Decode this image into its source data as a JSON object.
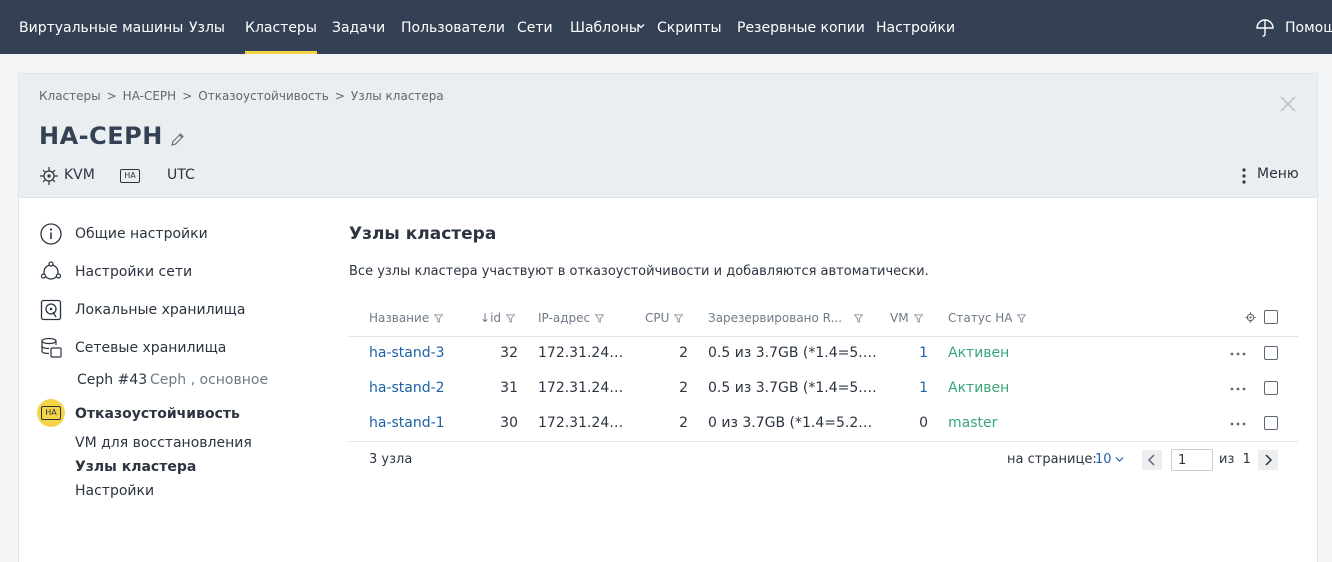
{
  "nav": {
    "items": [
      "Виртуальные машины",
      "Узлы",
      "Кластеры",
      "Задачи",
      "Пользователи",
      "Сети",
      "Шаблоны",
      "Скрипты",
      "Резервные копии",
      "Настройки"
    ],
    "active": "Кластеры",
    "help_label": "Помощь",
    "accent_color": "#f5d547"
  },
  "breadcrumb": [
    "Кластеры",
    "HA-CEPH",
    "Отказоустойчивость",
    "Узлы кластера"
  ],
  "header": {
    "title": "HA-CEPH",
    "tags": {
      "virtualization": "KVM",
      "ha_badge": "HA",
      "timezone": "UTC"
    },
    "menu_label": "Меню"
  },
  "sidebar": {
    "items": [
      {
        "label": "Общие настройки",
        "icon": "info-icon"
      },
      {
        "label": "Настройки сети",
        "icon": "network-icon"
      },
      {
        "label": "Локальные хранилища",
        "icon": "local-storage-icon"
      },
      {
        "label": "Сетевые хранилища",
        "icon": "network-storage-icon"
      },
      {
        "label": "Отказоустойчивость",
        "icon": "ha-icon"
      }
    ],
    "storage_sub": {
      "name": "Ceph #43",
      "desc": "Ceph , основное"
    },
    "ha_sub": [
      "VM для восстановления",
      "Узлы кластера",
      "Настройки"
    ],
    "ha_sub_active": "Узлы кластера"
  },
  "main": {
    "title": "Узлы кластера",
    "description": "Все узлы кластера участвуют в отказоустойчивости и добавляются автоматически.",
    "columns": [
      "Название",
      "id",
      "IP-адрес",
      "CPU",
      "Зарезервировано R...",
      "VM",
      "Статус HA"
    ],
    "sort_indicator": "↓",
    "rows": [
      {
        "name": "ha-stand-3",
        "id": "32",
        "ip": "172.31.24…",
        "cpu": "2",
        "reserved": "0.5 из 3.7GB (*1.4=5.…",
        "vm": "1",
        "status": "Активен"
      },
      {
        "name": "ha-stand-2",
        "id": "31",
        "ip": "172.31.24…",
        "cpu": "2",
        "reserved": "0.5 из 3.7GB (*1.4=5.…",
        "vm": "1",
        "status": "Активен"
      },
      {
        "name": "ha-stand-1",
        "id": "30",
        "ip": "172.31.24…",
        "cpu": "2",
        "reserved": "0 из 3.7GB (*1.4=5.2…",
        "vm": "0",
        "status": "master"
      }
    ],
    "footer": {
      "count": "3 узла",
      "per_page_label": "на странице:",
      "per_page_value": "10",
      "page_value": "1",
      "of_label": "из",
      "total_pages": "1"
    },
    "link_color": "#1d62a8",
    "status_color": "#3aa57a"
  }
}
